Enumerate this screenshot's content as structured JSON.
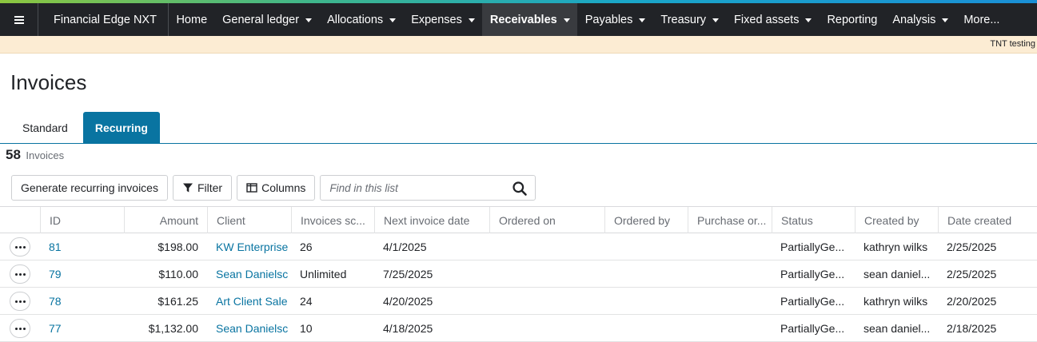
{
  "navbar": {
    "brand": "Financial Edge NXT",
    "items": [
      {
        "label": "Home",
        "dropdown": false,
        "active": false
      },
      {
        "label": "General ledger",
        "dropdown": true,
        "active": false
      },
      {
        "label": "Allocations",
        "dropdown": true,
        "active": false
      },
      {
        "label": "Expenses",
        "dropdown": true,
        "active": false
      },
      {
        "label": "Receivables",
        "dropdown": true,
        "active": true
      },
      {
        "label": "Payables",
        "dropdown": true,
        "active": false
      },
      {
        "label": "Treasury",
        "dropdown": true,
        "active": false
      },
      {
        "label": "Fixed assets",
        "dropdown": true,
        "active": false
      },
      {
        "label": "Reporting",
        "dropdown": false,
        "active": false
      },
      {
        "label": "Analysis",
        "dropdown": true,
        "active": false
      },
      {
        "label": "More...",
        "dropdown": false,
        "active": false
      }
    ]
  },
  "env_banner": "TNT testing",
  "page": {
    "title": "Invoices",
    "tabs": [
      {
        "label": "Standard",
        "active": false
      },
      {
        "label": "Recurring",
        "active": true
      }
    ],
    "count": "58",
    "count_label": "Invoices"
  },
  "toolbar": {
    "generate_label": "Generate recurring invoices",
    "filter_label": "Filter",
    "columns_label": "Columns",
    "search_placeholder": "Find in this list"
  },
  "grid": {
    "columns": [
      "ID",
      "Amount",
      "Client",
      "Invoices sc...",
      "Next invoice date",
      "Ordered on",
      "Ordered by",
      "Purchase or...",
      "Status",
      "Created by",
      "Date created"
    ],
    "rows": [
      {
        "id": "81",
        "amount": "$198.00",
        "client": "KW Enterprise",
        "invoices_scheduled": "26",
        "next_invoice_date": "4/1/2025",
        "ordered_on": "",
        "ordered_by": "",
        "purchase_order": "",
        "status": "PartiallyGe...",
        "created_by": "kathryn wilks",
        "date_created": "2/25/2025"
      },
      {
        "id": "79",
        "amount": "$110.00",
        "client": "Sean Danielsc",
        "invoices_scheduled": "Unlimited",
        "next_invoice_date": "7/25/2025",
        "ordered_on": "",
        "ordered_by": "",
        "purchase_order": "",
        "status": "PartiallyGe...",
        "created_by": "sean daniel...",
        "date_created": "2/25/2025"
      },
      {
        "id": "78",
        "amount": "$161.25",
        "client": "Art Client Sale",
        "invoices_scheduled": "24",
        "next_invoice_date": "4/20/2025",
        "ordered_on": "",
        "ordered_by": "",
        "purchase_order": "",
        "status": "PartiallyGe...",
        "created_by": "kathryn wilks",
        "date_created": "2/20/2025"
      },
      {
        "id": "77",
        "amount": "$1,132.00",
        "client": "Sean Danielsc",
        "invoices_scheduled": "10",
        "next_invoice_date": "4/18/2025",
        "ordered_on": "",
        "ordered_by": "",
        "purchase_order": "",
        "status": "PartiallyGe...",
        "created_by": "sean daniel...",
        "date_created": "2/18/2025"
      }
    ]
  },
  "icons": {
    "menu": "hamburger-icon",
    "filter": "filter-icon",
    "columns": "columns-icon",
    "search": "search-icon",
    "row_actions": "ellipsis-icon"
  },
  "colors": {
    "navbar_bg": "#212327",
    "nav_active_bg": "#393b3f",
    "accent_blue": "#0974a1",
    "banner_bg": "#fcecd3"
  }
}
